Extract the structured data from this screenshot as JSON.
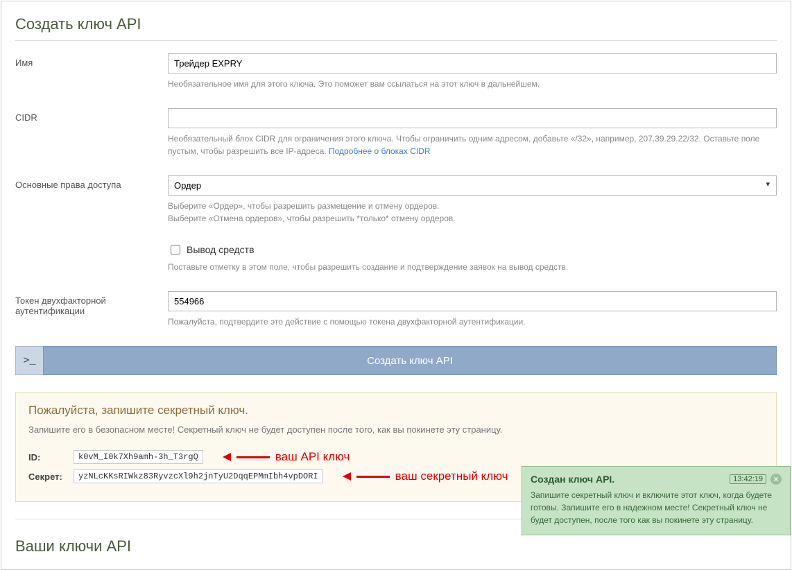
{
  "page": {
    "title": "Создать ключ API",
    "section2_title": "Ваши ключи API"
  },
  "form": {
    "name": {
      "label": "Имя",
      "value": "Трейдер EXPRY",
      "help": "Необязательное имя для этого ключа. Это поможет вам ссылаться на этот ключ в дальнейшем."
    },
    "cidr": {
      "label": "CIDR",
      "value": "",
      "help_prefix": "Необязательный блок CIDR для ограничения этого ключа. Чтобы ограничить одним адресом, добавьте «/32», например, 207.39.29.22/32. Оставьте поле пустым, чтобы разрешить все IP-адреса. ",
      "help_link": "Подробнее о блоках CIDR"
    },
    "perm": {
      "label": "Основные права доступа",
      "selected": "Ордер",
      "help1": "Выберите «Ордер», чтобы разрешить размещение и отмену ордеров.",
      "help2": "Выберите «Отмена ордеров», чтобы разрешить *только* отмену ордеров."
    },
    "withdraw": {
      "label": "Вывод средств",
      "help": "Поставьте отметку в этом поле, чтобы разрешить создание и подтверждение заявок на вывод средств."
    },
    "twofa": {
      "label": "Токен двухфакторной аутентификации",
      "value": "554966",
      "help": "Пожалуйста, подтвердите это действие с помощью токена двухфакторной аутентификации."
    },
    "submit_prompt": ">_",
    "submit": "Создать ключ API"
  },
  "secret": {
    "title": "Пожалуйста, запишите секретный ключ.",
    "desc": "Запишите его в безопасном месте! Секретный ключ не будет доступен после того, как вы покинете эту страницу.",
    "id_label": "ID:",
    "id_value": "k0vM_I0k7Xh9amh-3h_T3rgQ",
    "id_annot": "ваш API ключ",
    "secret_label": "Секрет:",
    "secret_value": "yzNLcKKsRIWkz83RyvzcXl9h2jnTyU2DqqEPMmIbh4vpDORI",
    "secret_annot": "ваш секретный ключ"
  },
  "toast": {
    "title": "Создан ключ API.",
    "time": "13:42:19",
    "body": "Запишите секретный ключ и включите этот ключ, когда будете готовы. Запишите его в надежном месте! Секретный ключ не будет доступен, после того как вы покинете эту страницу."
  }
}
